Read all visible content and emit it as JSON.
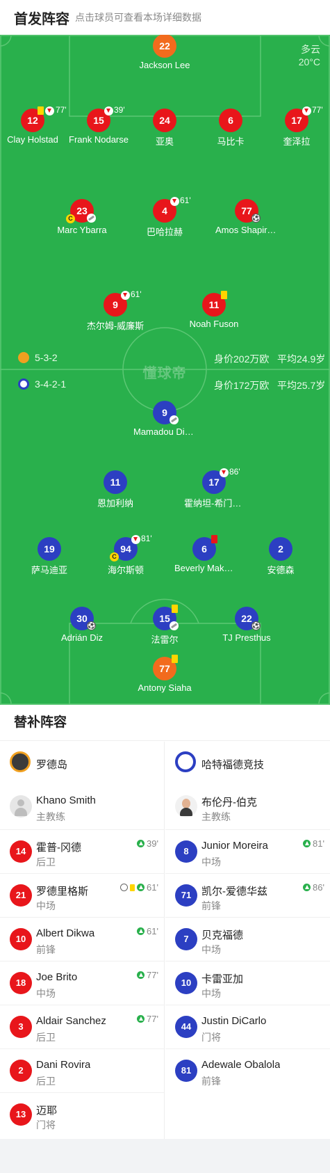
{
  "header": {
    "title": "首发阵容",
    "subtitle": "点击球员可查看本场详细数据"
  },
  "weather": {
    "condition": "多云",
    "temperature": "20°C"
  },
  "watermark": "懂球帝",
  "teams": {
    "home": {
      "formation": "5-3-2",
      "market_value": "身价202万欧",
      "avg_age": "平均24.9岁"
    },
    "away": {
      "formation": "3-4-2-1",
      "market_value": "身价172万欧",
      "avg_age": "平均25.7岁"
    }
  },
  "home_players": [
    {
      "number": "22",
      "name": "Jackson Lee",
      "gk": true
    },
    {
      "number": "12",
      "name": "Clay Holstad",
      "minute": "77'"
    },
    {
      "number": "15",
      "name": "Frank Nodarse",
      "minute": "39'"
    },
    {
      "number": "24",
      "name": "亚奥"
    },
    {
      "number": "6",
      "name": "马比卡"
    },
    {
      "number": "17",
      "name": "奎泽拉",
      "minute": "77'"
    },
    {
      "number": "23",
      "name": "Marc Ybarra"
    },
    {
      "number": "4",
      "name": "巴哈拉赫",
      "minute": "61'"
    },
    {
      "number": "77",
      "name": "Amos Shapiro-Thompson"
    },
    {
      "number": "9",
      "name": "杰尔姆-威廉斯",
      "minute": "61'"
    },
    {
      "number": "11",
      "name": "Noah Fuson"
    }
  ],
  "away_players": [
    {
      "number": "9",
      "name": "Mamadou Diallo"
    },
    {
      "number": "11",
      "name": "恩加利纳"
    },
    {
      "number": "17",
      "name": "霍纳坦-希门内斯",
      "minute": "86'"
    },
    {
      "number": "19",
      "name": "萨马迪亚"
    },
    {
      "number": "94",
      "name": "海尔斯顿",
      "minute": "81'"
    },
    {
      "number": "6",
      "name": "Beverly Makangila"
    },
    {
      "number": "2",
      "name": "安德森"
    },
    {
      "number": "30",
      "name": "Adrián Diz"
    },
    {
      "number": "15",
      "name": "法雷尔"
    },
    {
      "number": "22",
      "name": "TJ Presthus"
    },
    {
      "number": "77",
      "name": "Antony Siaha",
      "gk": true
    }
  ],
  "subs": {
    "title": "替补阵容",
    "home": {
      "team_name": "罗德岛",
      "coach": {
        "name": "Khano Smith",
        "role": "主教练"
      },
      "players": [
        {
          "number": "14",
          "name": "霍普-冈德",
          "position": "后卫",
          "minute": "39'"
        },
        {
          "number": "21",
          "name": "罗德里格斯",
          "position": "中场",
          "minute": "61'"
        },
        {
          "number": "10",
          "name": "Albert Dikwa",
          "position": "前锋",
          "minute": "61'"
        },
        {
          "number": "18",
          "name": "Joe Brito",
          "position": "中场",
          "minute": "77'"
        },
        {
          "number": "3",
          "name": "Aldair Sanchez",
          "position": "后卫",
          "minute": "77'"
        },
        {
          "number": "2",
          "name": "Dani Rovira",
          "position": "后卫"
        },
        {
          "number": "13",
          "name": "迈耶",
          "position": "门将"
        }
      ]
    },
    "away": {
      "team_name": "哈特福德竞技",
      "coach": {
        "name": "布伦丹-伯克",
        "role": "主教练"
      },
      "players": [
        {
          "number": "8",
          "name": "Junior Moreira",
          "position": "中场",
          "minute": "81'"
        },
        {
          "number": "71",
          "name": "凯尔-爱德华兹",
          "position": "前锋",
          "minute": "86'"
        },
        {
          "number": "7",
          "name": "贝克福德",
          "position": "中场"
        },
        {
          "number": "10",
          "name": "卡雷亚加",
          "position": "中场"
        },
        {
          "number": "44",
          "name": "Justin DiCarlo",
          "position": "门将"
        },
        {
          "number": "81",
          "name": "Adewale Obalola",
          "position": "前锋"
        }
      ]
    }
  },
  "colors": {
    "home": "#e8161b",
    "away": "#2c3fc2",
    "goalkeeper": "#f26b1d",
    "pitch": "#29b04c",
    "sub_in": "#29b04c",
    "yellow_card": "#ffd500"
  }
}
